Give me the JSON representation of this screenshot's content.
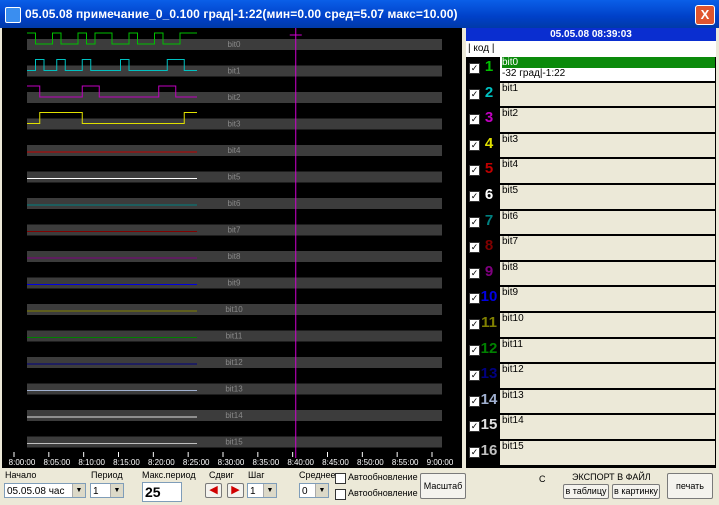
{
  "window": {
    "title": "05.05.08 примечание_0_0.100 град|-1:22(мин=0.00 сред=5.07 макс=10.00)",
    "close_label": "X"
  },
  "panel": {
    "datetime": "05.05.08 08:39:03",
    "header": "| код |",
    "active_value": "-32 град|-1:22"
  },
  "channels": [
    {
      "num": "1",
      "label": "bit0",
      "color": "#00c000",
      "checked": true
    },
    {
      "num": "2",
      "label": "bit1",
      "color": "#00c0c0",
      "checked": true
    },
    {
      "num": "3",
      "label": "bit2",
      "color": "#c000c0",
      "checked": true
    },
    {
      "num": "4",
      "label": "bit3",
      "color": "#e0e000",
      "checked": true
    },
    {
      "num": "5",
      "label": "bit4",
      "color": "#c00000",
      "checked": true
    },
    {
      "num": "6",
      "label": "bit5",
      "color": "#ffffff",
      "checked": true
    },
    {
      "num": "7",
      "label": "bit6",
      "color": "#008080",
      "checked": true
    },
    {
      "num": "8",
      "label": "bit7",
      "color": "#800000",
      "checked": true
    },
    {
      "num": "9",
      "label": "bit8",
      "color": "#800080",
      "checked": true
    },
    {
      "num": "10",
      "label": "bit9",
      "color": "#0000e0",
      "checked": true
    },
    {
      "num": "11",
      "label": "bit10",
      "color": "#808000",
      "checked": true
    },
    {
      "num": "12",
      "label": "bit11",
      "color": "#008000",
      "checked": true
    },
    {
      "num": "13",
      "label": "bit12",
      "color": "#000080",
      "checked": true
    },
    {
      "num": "14",
      "label": "bit13",
      "color": "#a0b0d0",
      "checked": true
    },
    {
      "num": "15",
      "label": "bit14",
      "color": "#e0e0e0",
      "checked": true
    },
    {
      "num": "16",
      "label": "bit15",
      "color": "#c0c0c0",
      "checked": true
    }
  ],
  "timeline": {
    "ticks": [
      "8:00:00",
      "8:05:00",
      "8:10:00",
      "8:15:00",
      "8:20:00",
      "8:25:00",
      "8:30:00",
      "8:35:00",
      "8:40:00",
      "8:45:00",
      "8:50:00",
      "8:55:00",
      "9:00:00"
    ],
    "cursor": "8:39:03"
  },
  "controls": {
    "start_label": "Начало",
    "start_value": "05.05.08 час",
    "period_label": "Период",
    "period_value": "1",
    "maxperiod_label": "Макс.период",
    "maxperiod_value": "25",
    "shift_label": "Сдвиг",
    "step_label": "Шаг",
    "step_value": "1",
    "avg_label": "Среднее",
    "avg_value": "0",
    "autoupdate1": "Автообновление",
    "autoupdate2": "Автообновление",
    "scale_button": "Масштаб",
    "c_label": "С",
    "export_label": "ЭКСПОРТ В ФАЙЛ",
    "to_table": "в таблицу",
    "to_picture": "в картинку",
    "print_button": "печать"
  }
}
